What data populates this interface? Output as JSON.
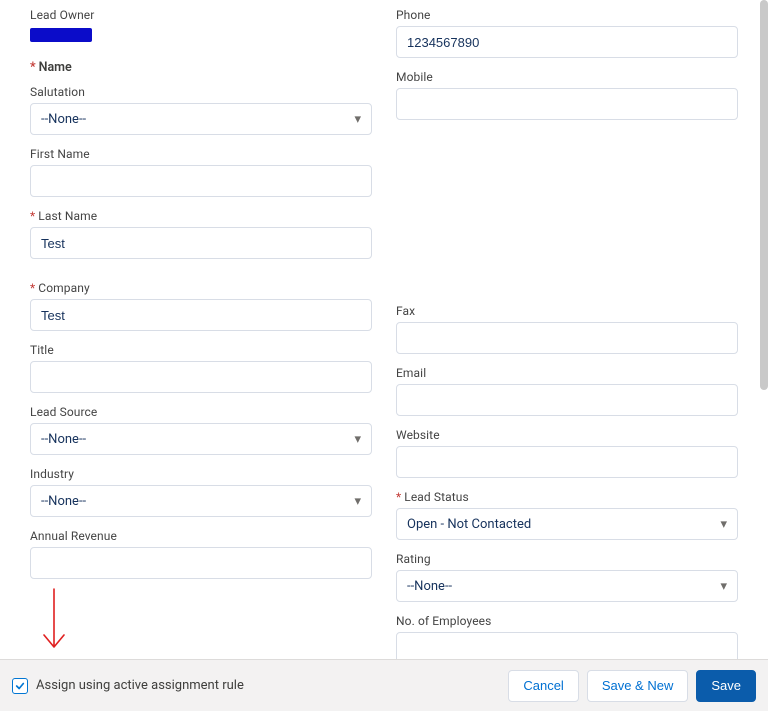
{
  "labels": {
    "lead_owner": "Lead Owner",
    "name_heading": "Name",
    "salutation": "Salutation",
    "first_name": "First Name",
    "last_name": "Last Name",
    "company": "Company",
    "title": "Title",
    "lead_source": "Lead Source",
    "industry": "Industry",
    "annual_revenue": "Annual Revenue",
    "phone": "Phone",
    "mobile": "Mobile",
    "fax": "Fax",
    "email": "Email",
    "website": "Website",
    "lead_status": "Lead Status",
    "rating": "Rating",
    "no_of_employees": "No. of Employees"
  },
  "values": {
    "salutation": "--None--",
    "first_name": "",
    "last_name": "Test",
    "company": "Test",
    "title": "",
    "lead_source": "--None--",
    "industry": "--None--",
    "annual_revenue": "",
    "phone": "1234567890",
    "mobile": "",
    "fax": "",
    "email": "",
    "website": "",
    "lead_status": "Open - Not Contacted",
    "rating": "--None--",
    "no_of_employees": ""
  },
  "footer": {
    "checkbox_checked": true,
    "checkbox_label": "Assign using active assignment rule",
    "cancel": "Cancel",
    "save_new": "Save & New",
    "save": "Save"
  },
  "required_marker": "*"
}
